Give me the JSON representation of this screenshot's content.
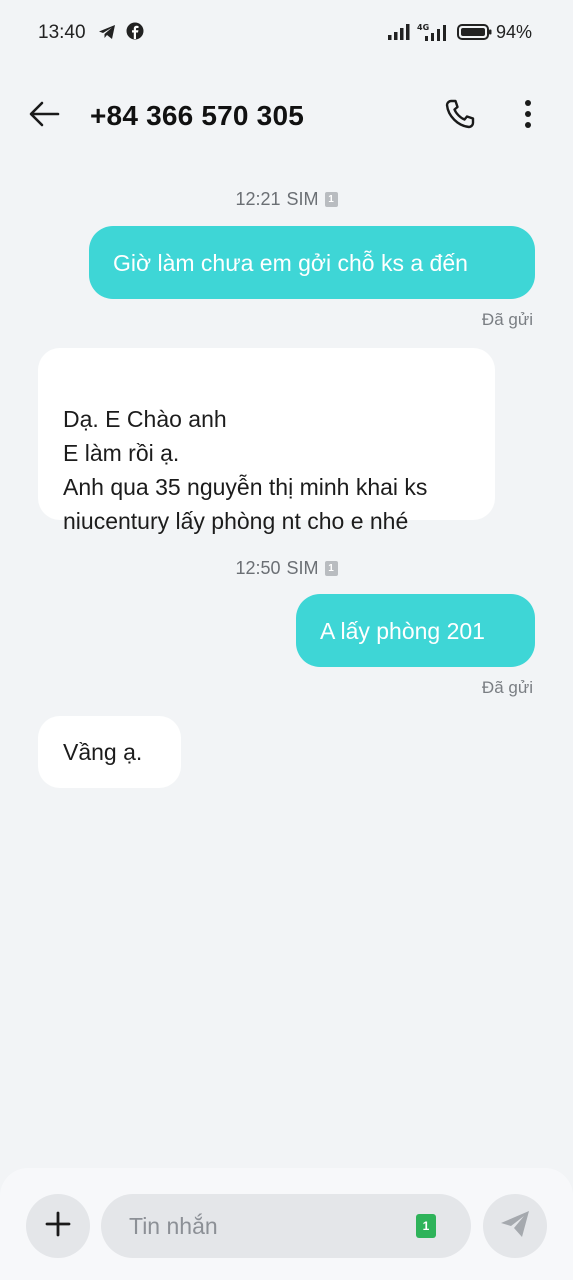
{
  "status_bar": {
    "time": "13:40",
    "network": "4G",
    "battery": "94%",
    "icons": [
      "telegram-icon",
      "facebook-icon",
      "signal-icon",
      "signal-4g-icon",
      "battery-icon"
    ]
  },
  "header": {
    "contact": "+84 366 570 305",
    "icons": [
      "back-arrow-icon",
      "phone-icon",
      "more-vertical-icon"
    ]
  },
  "conversation": {
    "groups": [
      {
        "timestamp": "12:21",
        "sim_label": "SIM",
        "sim_index": "1"
      },
      {
        "timestamp": "12:50",
        "sim_label": "SIM",
        "sim_index": "1"
      }
    ],
    "messages": [
      {
        "direction": "outgoing",
        "text": "Giờ làm chưa em gởi chỗ ks a đến",
        "status": "Đã gửi"
      },
      {
        "direction": "incoming",
        "text": "Dạ. E Chào anh\nE làm rồi ạ.\nAnh qua 35 nguyễn thị minh khai ks niucentury lấy phòng nt cho e nhé"
      },
      {
        "direction": "outgoing",
        "text": "A lấy phòng 201",
        "status": "Đã gửi"
      },
      {
        "direction": "incoming",
        "text": "Vầng ạ."
      }
    ]
  },
  "composer": {
    "placeholder": "Tin nhắn",
    "sim_index": "1",
    "icons": [
      "plus-icon",
      "sim-card-icon",
      "send-icon"
    ]
  },
  "colors": {
    "background": "#f2f4f6",
    "outgoing_bubble": "#3ed6d6",
    "incoming_bubble": "#ffffff",
    "sim_badge": "#2eb35a"
  }
}
